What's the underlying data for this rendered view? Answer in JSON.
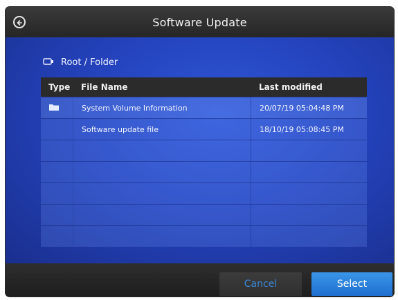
{
  "header": {
    "title": "Software Update",
    "back_icon": "back-arrow-icon"
  },
  "breadcrumb": {
    "icon": "drive-icon",
    "path": "Root / Folder"
  },
  "table": {
    "columns": [
      "Type",
      "File Name",
      "Last modified"
    ],
    "rows": [
      {
        "type_icon": "folder-icon",
        "name": "System Volume Information",
        "modified": "20/07/19 05:04:48 PM"
      },
      {
        "type_icon": "",
        "name": "Software update file",
        "modified": "18/10/19 05:08:45 PM"
      },
      {
        "type_icon": "",
        "name": "",
        "modified": ""
      },
      {
        "type_icon": "",
        "name": "",
        "modified": ""
      },
      {
        "type_icon": "",
        "name": "",
        "modified": ""
      },
      {
        "type_icon": "",
        "name": "",
        "modified": ""
      },
      {
        "type_icon": "",
        "name": "",
        "modified": ""
      }
    ]
  },
  "footer": {
    "cancel_label": "Cancel",
    "select_label": "Select"
  },
  "colors": {
    "accent": "#2a7fdd",
    "header_bg": "#2b2b2b",
    "panel_bg": "#2443bd"
  }
}
